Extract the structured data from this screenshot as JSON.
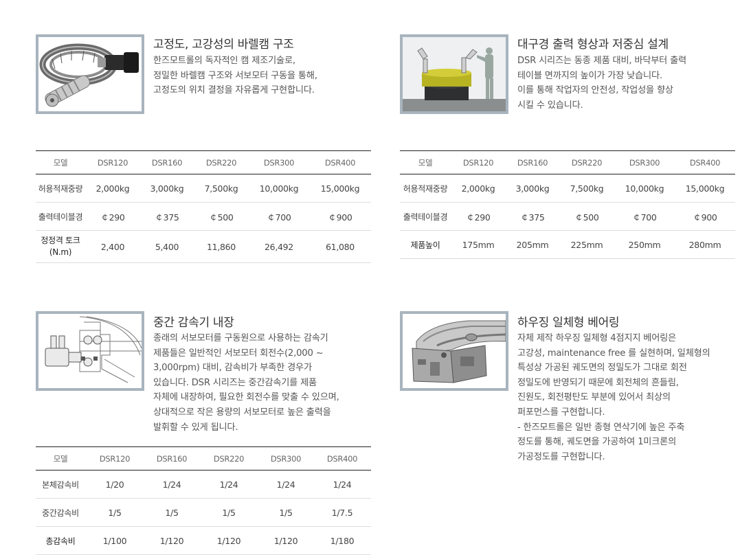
{
  "sections": [
    {
      "title": "고정도, 고강성의 바렐캠 구조",
      "image_icon": "barrel-cam-actuator-photo",
      "lines": [
        "한즈모트롤의 독자적인 캠 제조기술로,",
        "정밀한 바렐캠 구조와 서보모터 구동을 통해,",
        "고정도의 위치 결정을 자유롭게 구현합니다."
      ],
      "table": {
        "headers": [
          "모델",
          "DSR120",
          "DSR160",
          "DSR220",
          "DSR300",
          "DSR400"
        ],
        "rows": [
          {
            "label": "허용적재중량",
            "cells": [
              "2,000kg",
              "3,000kg",
              "7,500kg",
              "10,000kg",
              "15,000kg"
            ]
          },
          {
            "label": "출력테이블경",
            "cells": [
              "￠290",
              "￠375",
              "￠500",
              "￠700",
              "￠900"
            ]
          },
          {
            "label": "정정격 토크\n(N.m)",
            "cells": [
              "2,400",
              "5,400",
              "11,860",
              "26,492",
              "61,080"
            ]
          }
        ]
      }
    },
    {
      "title": "대구경 출력 형상과 저중심 설계",
      "image_icon": "low-height-table-with-worker-illustration",
      "lines": [
        "DSR 시리즈는 동종 제품 대비, 바닥부터 출력",
        "테이블 면까지의 높이가 가장 낮습니다.",
        "이를 통해 작업자의 안전성, 작업성을 향상",
        "시킬 수 있습니다."
      ],
      "table": {
        "headers": [
          "모델",
          "DSR120",
          "DSR160",
          "DSR220",
          "DSR300",
          "DSR400"
        ],
        "rows": [
          {
            "label": "허용적재중량",
            "cells": [
              "2,000kg",
              "3,000kg",
              "7,500kg",
              "10,000kg",
              "15,000kg"
            ]
          },
          {
            "label": "출력테이블경",
            "cells": [
              "￠290",
              "￠375",
              "￠500",
              "￠700",
              "￠900"
            ]
          },
          {
            "label": "제품높이",
            "cells": [
              "175mm",
              "205mm",
              "225mm",
              "250mm",
              "280mm"
            ]
          }
        ]
      }
    },
    {
      "title": "중간 감속기 내장",
      "image_icon": "reducer-cross-section-drawing",
      "lines": [
        "종래의 서보모터를 구동원으로 사용하는 감속기",
        "제품들은 일반적인 서보모터 회전수(2,000 ~",
        "3,000rpm) 대비, 감속비가 부족한 경우가",
        "있습니다. DSR 시리즈는 중간감속기를 제품",
        "자체에 내장하여, 필요한 회전수를 맞출 수 있으며,",
        "상대적으로 작은 용량의 서보모터로 높은 출력을",
        "발휘할 수 있게 됩니다."
      ],
      "table": {
        "headers": [
          "모델",
          "DSR120",
          "DSR160",
          "DSR220",
          "DSR300",
          "DSR400"
        ],
        "rows": [
          {
            "label": "본체감속비",
            "cells": [
              "1/20",
              "1/24",
              "1/24",
              "1/24",
              "1/24"
            ]
          },
          {
            "label": "중간감속비",
            "cells": [
              "1/5",
              "1/5",
              "1/5",
              "1/5",
              "1/7.5"
            ]
          },
          {
            "label": "총감속비",
            "cells": [
              "1/100",
              "1/120",
              "1/120",
              "1/120",
              "1/180"
            ]
          }
        ]
      }
    },
    {
      "title": "하우징 일체형 베어링",
      "image_icon": "integrated-housing-bearing-cutaway",
      "lines": [
        "자체 제작 하우징 일체형 4점지지 베어링은",
        "고강성, maintenance free 를 실현하며, 일체형의",
        "특성상 가공된 궤도면의 정밀도가 그대로 회전",
        "정밀도에 반영되기 때문에 회전체의 흔들림,",
        "진원도, 회전평탄도 부분에 있어서 최상의",
        "퍼포먼스를 구현합니다.",
        "- 한즈모트롤은 일반 종형 연삭기에 높은 주축",
        "정도를 통해, 궤도면을 가공하여 1미크론의",
        "가공정도를 구현합니다."
      ]
    }
  ]
}
